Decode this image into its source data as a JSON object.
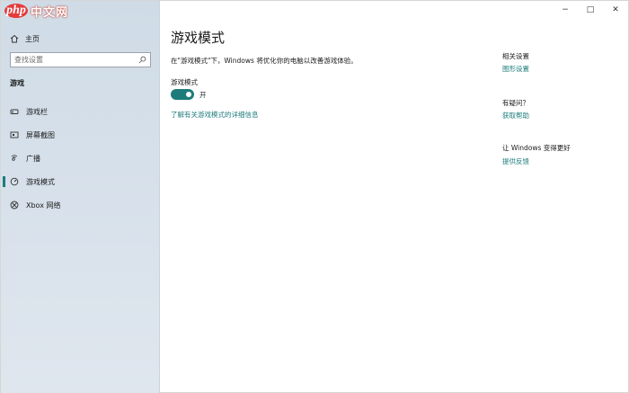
{
  "watermark": {
    "brand_mark": "php",
    "brand_text": "中文网"
  },
  "window_controls": {
    "minimize": "−",
    "maximize": "□",
    "close": "✕"
  },
  "sidebar": {
    "home_label": "主页",
    "search_placeholder": "查找设置",
    "section_label": "游戏",
    "items": [
      {
        "label": "游戏栏",
        "icon": "game-bar-icon"
      },
      {
        "label": "屏幕截图",
        "icon": "capture-icon"
      },
      {
        "label": "广播",
        "icon": "broadcast-icon"
      },
      {
        "label": "游戏模式",
        "icon": "game-mode-icon",
        "active": true
      },
      {
        "label": "Xbox 网络",
        "icon": "xbox-icon"
      }
    ]
  },
  "main": {
    "title": "游戏模式",
    "description": "在\"游戏模式\"下，Windows 将优化你的电脑以改善游戏体验。",
    "toggle_label": "游戏模式",
    "toggle_state": "开",
    "learn_more": "了解有关游戏模式的详细信息"
  },
  "right_panel": {
    "related_heading": "相关设置",
    "related_link": "图形设置",
    "question_heading": "有疑问？",
    "question_link": "获取帮助",
    "feedback_heading": "让 Windows 变得更好",
    "feedback_link": "提供反馈"
  },
  "colors": {
    "accent": "#1e7b7b",
    "sidebar_bg": "#d6e0ea"
  }
}
